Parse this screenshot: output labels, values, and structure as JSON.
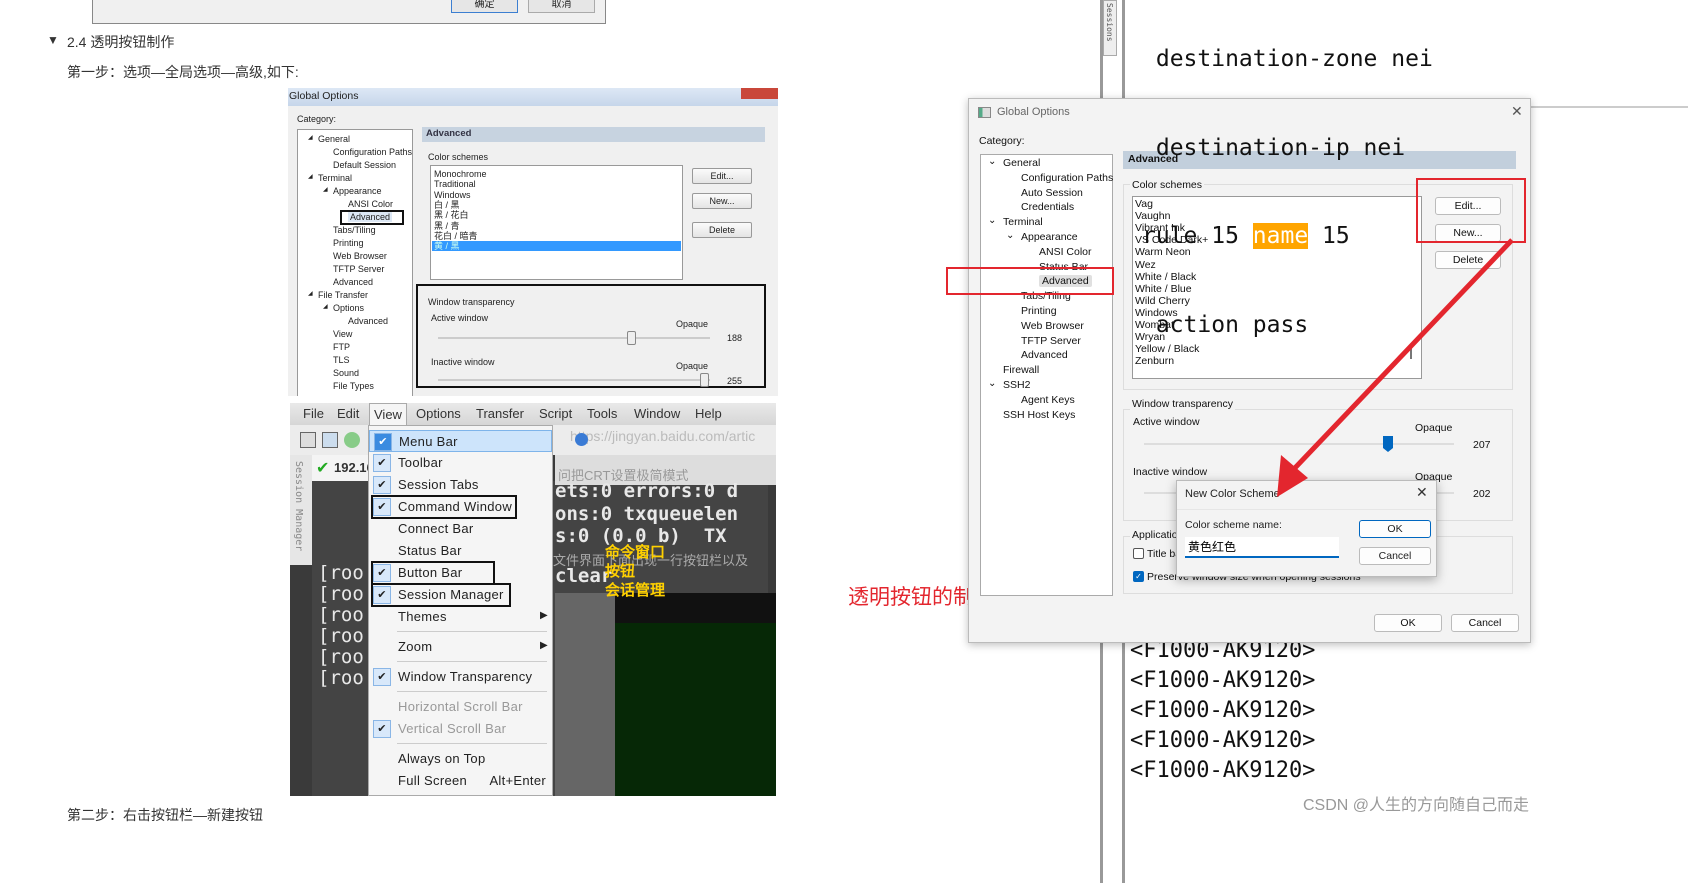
{
  "doc": {
    "top_dialog": {
      "ok": "确定",
      "cancel": "取消"
    },
    "heading": "2.4 透明按钮制作",
    "heading_toggle": "▼",
    "step1": "第一步：选项—全局选项—高级,如下:",
    "step2": "第二步：右击按钮栏—新建按钮",
    "annotation": "透明按钮的制作"
  },
  "old_dialog": {
    "title": "Global Options",
    "category_label": "Category:",
    "tree": [
      {
        "label": "General",
        "level": 0,
        "expander": true
      },
      {
        "label": "Configuration Paths",
        "level": 1
      },
      {
        "label": "Default Session",
        "level": 1
      },
      {
        "label": "Terminal",
        "level": 0,
        "expander": true
      },
      {
        "label": "Appearance",
        "level": 1,
        "expander": true
      },
      {
        "label": "ANSI Color",
        "level": 2
      },
      {
        "label": "Advanced",
        "level": 2,
        "selected": true
      },
      {
        "label": "Tabs/Tiling",
        "level": 1
      },
      {
        "label": "Printing",
        "level": 1
      },
      {
        "label": "Web Browser",
        "level": 1
      },
      {
        "label": "TFTP Server",
        "level": 1
      },
      {
        "label": "Advanced",
        "level": 1
      },
      {
        "label": "File Transfer",
        "level": 0,
        "expander": true
      },
      {
        "label": "Options",
        "level": 1,
        "expander": true
      },
      {
        "label": "Advanced",
        "level": 2
      },
      {
        "label": "View",
        "level": 1
      },
      {
        "label": "FTP",
        "level": 1
      },
      {
        "label": "TLS",
        "level": 1
      },
      {
        "label": "Sound",
        "level": 1
      },
      {
        "label": "File Types",
        "level": 1
      }
    ],
    "section_header": "Advanced",
    "color_schemes_label": "Color schemes",
    "color_schemes": [
      "Monochrome",
      "Traditional",
      "Windows",
      "白 / 黑",
      "黑 / 花白",
      "黑 / 青",
      "花白 / 暗青",
      "黄 / 黑"
    ],
    "selected_scheme": "黄 / 黑",
    "buttons": {
      "edit": "Edit...",
      "new": "New...",
      "delete": "Delete"
    },
    "transparency_label": "Window transparency",
    "active_label": "Active window",
    "inactive_label": "Inactive window",
    "opaque": "Opaque",
    "active_value": "188",
    "inactive_value": "255"
  },
  "menu_shot": {
    "menubar": [
      "File",
      "Edit",
      "View",
      "Options",
      "Transfer",
      "Script",
      "Tools",
      "Window",
      "Help"
    ],
    "url_text": "https://jingyan.baidu.com/artic",
    "tab_label": "192.16",
    "side_tab": "Session Manager",
    "items": [
      {
        "label": "Menu Bar",
        "checked": true,
        "highlight": true
      },
      {
        "label": "Toolbar",
        "checked": true
      },
      {
        "label": "Session Tabs",
        "checked": true
      },
      {
        "label": "Command Window",
        "checked": true,
        "boxed": true
      },
      {
        "label": "Connect Bar"
      },
      {
        "label": "Status Bar"
      },
      {
        "label": "Button Bar",
        "checked": true,
        "boxed": true
      },
      {
        "label": "Session Manager",
        "checked": true,
        "boxed": true
      },
      {
        "label": "Themes",
        "submenu": true,
        "sep_after": true
      },
      {
        "label": "Zoom",
        "submenu": true,
        "sep_after": true
      },
      {
        "label": "Window Transparency",
        "checked": true,
        "sep_after": true
      },
      {
        "label": "Horizontal Scroll Bar",
        "disabled": true
      },
      {
        "label": "Vertical Scroll Bar",
        "checked": true,
        "disabled": true,
        "sep_after": true
      },
      {
        "label": "Always on Top"
      },
      {
        "label": "Full Screen",
        "shortcut": "Alt+Enter"
      }
    ],
    "terminal_lines": [
      "ets:0 errors:0 d",
      "ons:0 txqueuelen",
      "s:0 (0.0 b)  TX",
      "clear"
    ],
    "prompt_lines": [
      "[roo",
      "[roo",
      "[roo",
      "[roo",
      "[roo",
      "[roo"
    ],
    "overlay_text": "问把CRT设置极简模式",
    "overlay_text2": "文件界面下面出现一行按钮栏以及",
    "annotations": [
      "命令窗口",
      "按钮",
      "会话管理"
    ]
  },
  "terminal": {
    "side_tab": "Sessions",
    "top_lines": [
      " destination-zone nei",
      " destination-ip nei"
    ],
    "rule_prefix": "rule 15 ",
    "rule_highlight": "name",
    "rule_suffix": " 15",
    "action_line": " action pass",
    "bottom_lines": [
      "<F1000-AK9120>",
      "<F1000-AK9120>",
      "<F1000-AK9120>",
      "<F1000-AK9120>",
      "<F1000-AK9120>"
    ],
    "highlight_color": "#ffa500"
  },
  "new_dialog": {
    "title": "Global Options",
    "category_label": "Category:",
    "tree": [
      {
        "label": "General",
        "level": 0,
        "expander": true
      },
      {
        "label": "Configuration Paths",
        "level": 1
      },
      {
        "label": "Auto Session",
        "level": 1
      },
      {
        "label": "Credentials",
        "level": 1
      },
      {
        "label": "Terminal",
        "level": 0,
        "expander": true
      },
      {
        "label": "Appearance",
        "level": 1,
        "expander": true
      },
      {
        "label": "ANSI Color",
        "level": 2
      },
      {
        "label": "Status Bar",
        "level": 2
      },
      {
        "label": "Advanced",
        "level": 2,
        "selected": true
      },
      {
        "label": "Tabs/Tiling",
        "level": 1
      },
      {
        "label": "Printing",
        "level": 1
      },
      {
        "label": "Web Browser",
        "level": 1
      },
      {
        "label": "TFTP Server",
        "level": 1
      },
      {
        "label": "Advanced",
        "level": 1
      },
      {
        "label": "Firewall",
        "level": 0
      },
      {
        "label": "SSH2",
        "level": 0,
        "expander": true
      },
      {
        "label": "Agent Keys",
        "level": 1
      },
      {
        "label": "SSH Host Keys",
        "level": 0
      }
    ],
    "section_header": "Advanced",
    "color_schemes_label": "Color schemes",
    "color_schemes": [
      "Vag",
      "Vaughn",
      "Vibrant Ink",
      "VS Code Dark+",
      "Warm Neon",
      "Wez",
      "White / Black",
      "White / Blue",
      "Wild Cherry",
      "Windows",
      "Wombat",
      "Wryan",
      "Yellow / Black",
      "Zenburn"
    ],
    "buttons": {
      "edit": "Edit...",
      "new": "New...",
      "delete": "Delete",
      "ok": "OK",
      "cancel": "Cancel"
    },
    "transparency_label": "Window transparency",
    "active_label": "Active window",
    "inactive_label": "Inactive window",
    "opaque": "Opaque",
    "active_value": "207",
    "inactive_value": "202",
    "application_label": "Application",
    "title_bar_checkbox": "Title ba",
    "title_bar_checked": false,
    "preserve_checkbox": "Preserve window size when opening sessions",
    "preserve_checked": true,
    "accent": "#0067c0"
  },
  "new_scheme_dialog": {
    "title": "New Color Scheme",
    "name_label": "Color scheme name:",
    "name_value": "黄色红色",
    "ok": "OK",
    "cancel": "Cancel"
  },
  "watermark": "CSDN @人生的方向随自己而走",
  "colors": {
    "annotation_red": "#e3262e",
    "selection_blue": "#3399ff"
  }
}
